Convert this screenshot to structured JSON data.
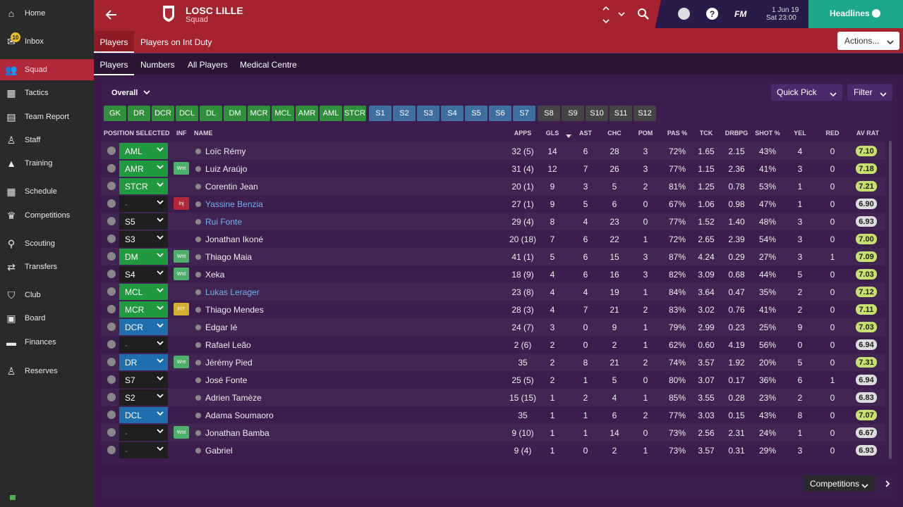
{
  "sidebar": {
    "items": [
      {
        "label": "Home",
        "icon": "home-icon"
      },
      {
        "label": "Inbox",
        "icon": "inbox-icon",
        "badge": "10"
      },
      {
        "label": "Squad",
        "icon": "squad-icon",
        "active": true
      },
      {
        "label": "Tactics",
        "icon": "tactics-icon"
      },
      {
        "label": "Team Report",
        "icon": "report-icon"
      },
      {
        "label": "Staff",
        "icon": "staff-icon"
      },
      {
        "label": "Training",
        "icon": "training-icon"
      },
      {
        "label": "Schedule",
        "icon": "calendar-icon"
      },
      {
        "label": "Competitions",
        "icon": "trophy-icon"
      },
      {
        "label": "Scouting",
        "icon": "search-icon"
      },
      {
        "label": "Transfers",
        "icon": "transfer-icon"
      },
      {
        "label": "Club",
        "icon": "shield-icon"
      },
      {
        "label": "Board",
        "icon": "briefcase-icon"
      },
      {
        "label": "Finances",
        "icon": "money-icon"
      },
      {
        "label": "Reserves",
        "icon": "reserves-icon"
      }
    ]
  },
  "header": {
    "club_name": "LOSC LILLE",
    "subtitle": "Squad",
    "date": "1 Jun 19",
    "time": "Sat 23:00",
    "fm_label": "FM",
    "headlines_label": "Headlines",
    "actions_label": "Actions..."
  },
  "tabs_top": [
    "Players",
    "Players on Int Duty"
  ],
  "tabs_sub": [
    "Players",
    "Numbers",
    "All Players",
    "Medical Centre"
  ],
  "toolbar": {
    "view_label": "Overall",
    "quick_pick_label": "Quick Pick",
    "filter_label": "Filter"
  },
  "position_pills": [
    {
      "label": "GK",
      "color": "green"
    },
    {
      "label": "DR",
      "color": "green"
    },
    {
      "label": "DCR",
      "color": "green"
    },
    {
      "label": "DCL",
      "color": "green"
    },
    {
      "label": "DL",
      "color": "green"
    },
    {
      "label": "DM",
      "color": "green"
    },
    {
      "label": "MCR",
      "color": "green"
    },
    {
      "label": "MCL",
      "color": "green"
    },
    {
      "label": "AMR",
      "color": "green"
    },
    {
      "label": "AML",
      "color": "green"
    },
    {
      "label": "STCR",
      "color": "green"
    },
    {
      "label": "S1",
      "color": "blue"
    },
    {
      "label": "S2",
      "color": "blue"
    },
    {
      "label": "S3",
      "color": "blue"
    },
    {
      "label": "S4",
      "color": "blue"
    },
    {
      "label": "S5",
      "color": "blue"
    },
    {
      "label": "S6",
      "color": "blue"
    },
    {
      "label": "S7",
      "color": "blue"
    },
    {
      "label": "S8",
      "color": "grey"
    },
    {
      "label": "S9",
      "color": "grey"
    },
    {
      "label": "S10",
      "color": "grey"
    },
    {
      "label": "S11",
      "color": "grey"
    },
    {
      "label": "S12",
      "color": "grey"
    }
  ],
  "columns": [
    "POSITION SELECTED",
    "INF",
    "NAME",
    "APPS",
    "GLS",
    "AST",
    "CHC",
    "POM",
    "PAS %",
    "TCK",
    "DRBPG",
    "SHOT %",
    "YEL",
    "RED",
    "AV RAT"
  ],
  "players": [
    {
      "pos": "AML",
      "pos_color": "green",
      "inf": "",
      "name": "Loïc Rémy",
      "link": false,
      "apps": "32 (5)",
      "gls": "14",
      "ast": "6",
      "chc": "28",
      "pom": "3",
      "pas": "72%",
      "tck": "1.65",
      "drb": "2.15",
      "shot": "43%",
      "yel": "4",
      "red": "0",
      "rat": "7.10",
      "rat_color": "#c8e070"
    },
    {
      "pos": "AMR",
      "pos_color": "green",
      "inf": "Wnt",
      "name": "Luiz Araújo",
      "link": false,
      "apps": "31 (4)",
      "gls": "12",
      "ast": "7",
      "chc": "26",
      "pom": "3",
      "pas": "77%",
      "tck": "1.15",
      "drb": "2.36",
      "shot": "41%",
      "yel": "3",
      "red": "0",
      "rat": "7.18",
      "rat_color": "#c8e070"
    },
    {
      "pos": "STCR",
      "pos_color": "green",
      "inf": "",
      "name": "Corentin Jean",
      "link": false,
      "apps": "20 (1)",
      "gls": "9",
      "ast": "3",
      "chc": "5",
      "pom": "2",
      "pas": "81%",
      "tck": "1.25",
      "drb": "0.78",
      "shot": "53%",
      "yel": "1",
      "red": "0",
      "rat": "7.21",
      "rat_color": "#c8e070"
    },
    {
      "pos": "-",
      "pos_color": "dark",
      "inf": "Inj",
      "name": "Yassine Benzia",
      "link": true,
      "apps": "27 (1)",
      "gls": "9",
      "ast": "5",
      "chc": "6",
      "pom": "0",
      "pas": "67%",
      "tck": "1.06",
      "drb": "0.98",
      "shot": "47%",
      "yel": "1",
      "red": "0",
      "rat": "6.90",
      "rat_color": "#dddddd"
    },
    {
      "pos": "S5",
      "pos_color": "dark",
      "inf": "",
      "name": "Rui Fonte",
      "link": true,
      "apps": "29 (4)",
      "gls": "8",
      "ast": "4",
      "chc": "23",
      "pom": "0",
      "pas": "77%",
      "tck": "1.52",
      "drb": "1.40",
      "shot": "48%",
      "yel": "3",
      "red": "0",
      "rat": "6.93",
      "rat_color": "#dddddd"
    },
    {
      "pos": "S3",
      "pos_color": "dark",
      "inf": "",
      "name": "Jonathan Ikoné",
      "link": false,
      "apps": "20 (18)",
      "gls": "7",
      "ast": "6",
      "chc": "22",
      "pom": "1",
      "pas": "72%",
      "tck": "2.65",
      "drb": "2.39",
      "shot": "54%",
      "yel": "3",
      "red": "0",
      "rat": "7.00",
      "rat_color": "#c8e070"
    },
    {
      "pos": "DM",
      "pos_color": "green",
      "inf": "Wnt",
      "name": "Thiago Maia",
      "link": false,
      "apps": "41 (1)",
      "gls": "5",
      "ast": "6",
      "chc": "15",
      "pom": "3",
      "pas": "87%",
      "tck": "4.24",
      "drb": "0.29",
      "shot": "27%",
      "yel": "3",
      "red": "1",
      "rat": "7.09",
      "rat_color": "#c8e070"
    },
    {
      "pos": "S4",
      "pos_color": "dark",
      "inf": "Wnt",
      "name": "Xeka",
      "link": false,
      "apps": "18 (9)",
      "gls": "4",
      "ast": "6",
      "chc": "16",
      "pom": "3",
      "pas": "82%",
      "tck": "3.09",
      "drb": "0.68",
      "shot": "44%",
      "yel": "5",
      "red": "0",
      "rat": "7.03",
      "rat_color": "#c8e070"
    },
    {
      "pos": "MCL",
      "pos_color": "green",
      "inf": "",
      "name": "Lukas Lerager",
      "link": true,
      "apps": "23 (8)",
      "gls": "4",
      "ast": "4",
      "chc": "19",
      "pom": "1",
      "pas": "84%",
      "tck": "3.64",
      "drb": "0.47",
      "shot": "35%",
      "yel": "2",
      "red": "0",
      "rat": "7.12",
      "rat_color": "#c8e070"
    },
    {
      "pos": "MCR",
      "pos_color": "green",
      "inf": "FIT",
      "name": "Thiago Mendes",
      "link": false,
      "apps": "28 (3)",
      "gls": "4",
      "ast": "7",
      "chc": "21",
      "pom": "2",
      "pas": "83%",
      "tck": "3.02",
      "drb": "0.76",
      "shot": "41%",
      "yel": "2",
      "red": "0",
      "rat": "7.11",
      "rat_color": "#c8e070"
    },
    {
      "pos": "DCR",
      "pos_color": "blue",
      "inf": "",
      "name": "Edgar Ié",
      "link": false,
      "apps": "24 (7)",
      "gls": "3",
      "ast": "0",
      "chc": "9",
      "pom": "1",
      "pas": "79%",
      "tck": "2.99",
      "drb": "0.23",
      "shot": "25%",
      "yel": "9",
      "red": "0",
      "rat": "7.03",
      "rat_color": "#c8e070"
    },
    {
      "pos": "-",
      "pos_color": "dark",
      "inf": "",
      "name": "Rafael Leão",
      "link": false,
      "apps": "2 (6)",
      "gls": "2",
      "ast": "0",
      "chc": "2",
      "pom": "1",
      "pas": "62%",
      "tck": "0.60",
      "drb": "4.19",
      "shot": "56%",
      "yel": "0",
      "red": "0",
      "rat": "6.94",
      "rat_color": "#dddddd"
    },
    {
      "pos": "DR",
      "pos_color": "blue",
      "inf": "Wnt",
      "name": "Jérémy Pied",
      "link": false,
      "apps": "35",
      "gls": "2",
      "ast": "8",
      "chc": "21",
      "pom": "2",
      "pas": "74%",
      "tck": "3.57",
      "drb": "1.92",
      "shot": "20%",
      "yel": "5",
      "red": "0",
      "rat": "7.31",
      "rat_color": "#c8e070"
    },
    {
      "pos": "S7",
      "pos_color": "dark",
      "inf": "",
      "name": "José Fonte",
      "link": false,
      "apps": "25 (5)",
      "gls": "2",
      "ast": "1",
      "chc": "5",
      "pom": "0",
      "pas": "80%",
      "tck": "3.07",
      "drb": "0.17",
      "shot": "36%",
      "yel": "6",
      "red": "1",
      "rat": "6.94",
      "rat_color": "#dddddd"
    },
    {
      "pos": "S2",
      "pos_color": "dark",
      "inf": "",
      "name": "Adrien Tamèze",
      "link": false,
      "apps": "15 (15)",
      "gls": "1",
      "ast": "2",
      "chc": "4",
      "pom": "1",
      "pas": "85%",
      "tck": "3.55",
      "drb": "0.28",
      "shot": "23%",
      "yel": "2",
      "red": "0",
      "rat": "6.83",
      "rat_color": "#dddddd"
    },
    {
      "pos": "DCL",
      "pos_color": "blue",
      "inf": "",
      "name": "Adama Soumaoro",
      "link": false,
      "apps": "35",
      "gls": "1",
      "ast": "1",
      "chc": "6",
      "pom": "2",
      "pas": "77%",
      "tck": "3.03",
      "drb": "0.15",
      "shot": "43%",
      "yel": "8",
      "red": "0",
      "rat": "7.07",
      "rat_color": "#c8e070"
    },
    {
      "pos": "-",
      "pos_color": "dark",
      "inf": "Wnt",
      "name": "Jonathan Bamba",
      "link": false,
      "apps": "9 (10)",
      "gls": "1",
      "ast": "1",
      "chc": "14",
      "pom": "0",
      "pas": "73%",
      "tck": "2.56",
      "drb": "2.31",
      "shot": "24%",
      "yel": "1",
      "red": "0",
      "rat": "6.67",
      "rat_color": "#dddddd"
    },
    {
      "pos": "-",
      "pos_color": "dark",
      "inf": "",
      "name": "Gabriel",
      "link": false,
      "apps": "9 (4)",
      "gls": "1",
      "ast": "0",
      "chc": "2",
      "pom": "1",
      "pas": "73%",
      "tck": "3.57",
      "drb": "0.31",
      "shot": "29%",
      "yel": "3",
      "red": "0",
      "rat": "6.93",
      "rat_color": "#dddddd"
    }
  ],
  "footer": {
    "competitions_label": "Competitions"
  }
}
